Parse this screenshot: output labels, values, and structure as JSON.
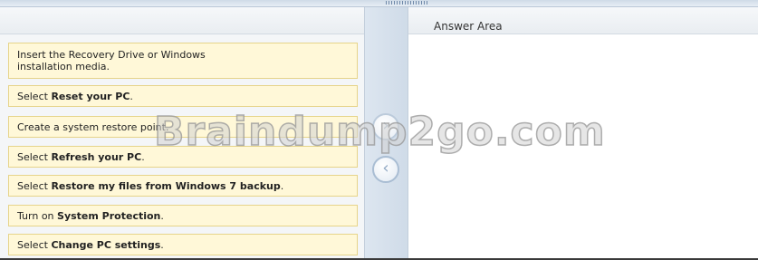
{
  "answer_area": {
    "title": "Answer Area"
  },
  "items": [
    {
      "pre": "Insert the Recovery Drive or Windows installation media.",
      "bold": "",
      "post": ""
    },
    {
      "pre": "Select ",
      "bold": "Reset your PC",
      "post": "."
    },
    {
      "pre": "Create a system restore point.",
      "bold": "",
      "post": ""
    },
    {
      "pre": "Select ",
      "bold": "Refresh your PC",
      "post": "."
    },
    {
      "pre": "Select ",
      "bold": "Restore my files from Windows 7 backup",
      "post": "."
    },
    {
      "pre": "Turn on ",
      "bold": "System Protection",
      "post": "."
    },
    {
      "pre": "Select ",
      "bold": "Change PC settings",
      "post": "."
    }
  ],
  "buttons": {
    "move_right_glyph": "›",
    "move_left_glyph": "‹"
  },
  "watermark": {
    "text": "Braindump2go.com"
  }
}
